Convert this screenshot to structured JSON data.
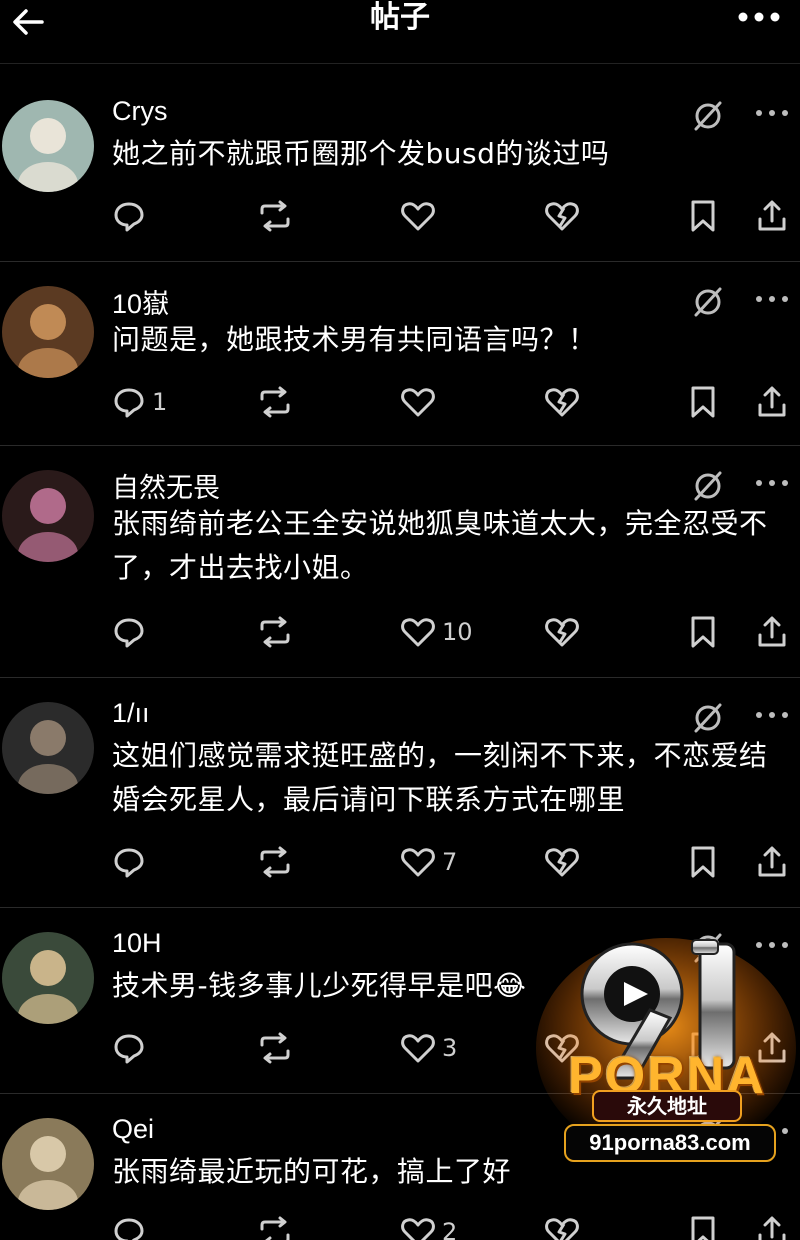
{
  "header": {
    "title": "帖子",
    "back_icon": "back-arrow-icon",
    "more_icon": "more-icon"
  },
  "posts": [
    {
      "username": "Crys",
      "text": "她之前不就跟币圈那个发busd的谈过吗",
      "replies": "",
      "likes": "",
      "replies_count": null
    },
    {
      "username": "10嶽",
      "text": "问题是，她跟技术男有共同语言吗？！",
      "replies": "1",
      "likes": ""
    },
    {
      "username": "自然无畏",
      "text": "张雨绮前老公王全安说她狐臭味道太大，完全忍受不了，才出去找小姐。",
      "replies": "",
      "likes": "10"
    },
    {
      "username": "1/ıı",
      "text": "这姐们感觉需求挺旺盛的，一刻闲不下来，不恋爱结婚会死星人，最后请问下联系方式在哪里",
      "replies": "",
      "likes": "7"
    },
    {
      "username": "10H",
      "text": "技术男-钱多事儿少死得早是吧😂",
      "replies": "",
      "likes": "3"
    },
    {
      "username": "Qei",
      "text": "张雨绮最近玩的可花，搞上了好",
      "replies": "",
      "likes": "2"
    }
  ],
  "watermark": {
    "number": "91",
    "brand": "PORNA",
    "subtitle": "永久地址",
    "domain": "91porna83.com"
  },
  "colors": {
    "background": "#000000",
    "text": "#ffffff",
    "icon": "#d0d0d0",
    "divider": "#2a2a2a"
  }
}
